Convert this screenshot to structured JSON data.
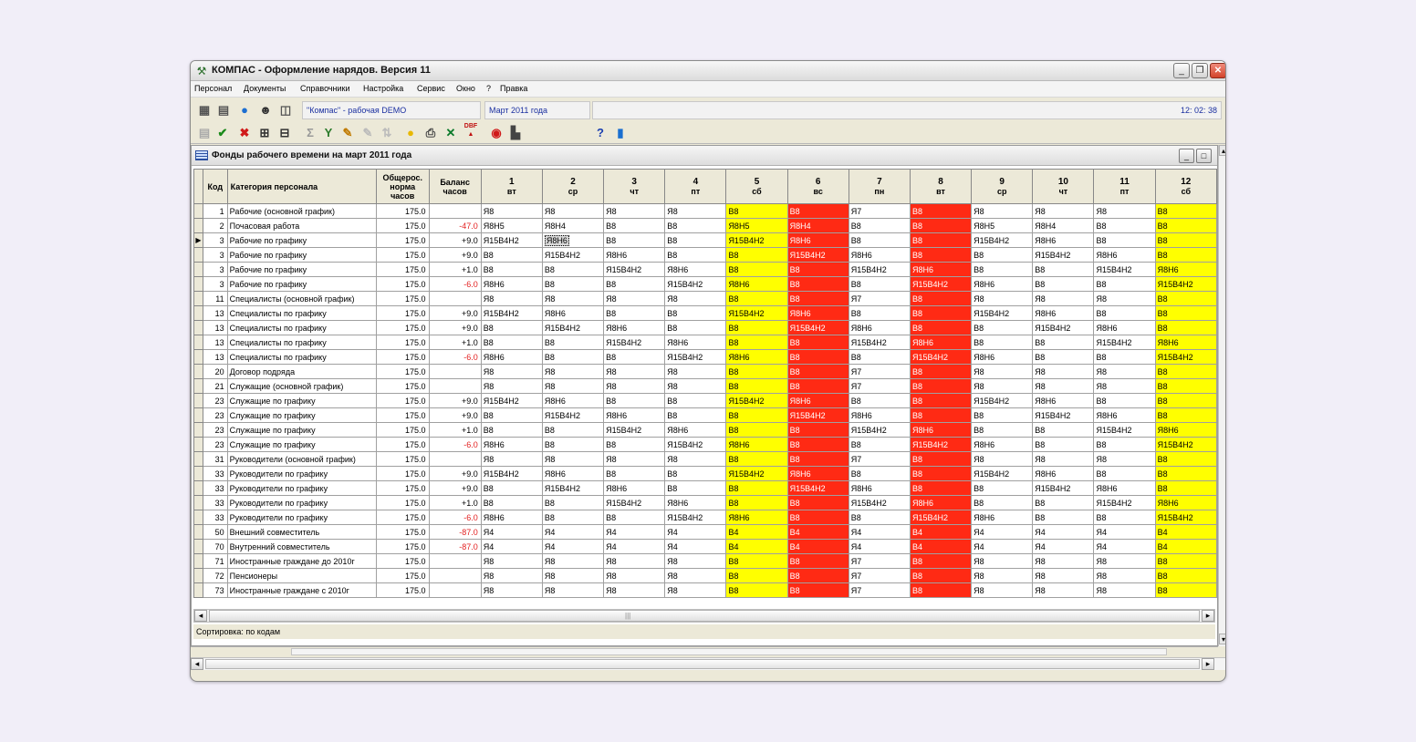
{
  "window": {
    "title": "КОМПАС - Оформление нарядов. Версия 11",
    "buttons": {
      "minimize": "_",
      "maximize": "❐",
      "close": "✕"
    }
  },
  "menu": [
    "Персонал",
    "Документы",
    "Справочники",
    "Настройка",
    "Сервис",
    "Окно",
    "?",
    "Правка"
  ],
  "toolbar": {
    "company": "\"Компас\" - рабочая DEMO",
    "period": "Март 2011 года",
    "clock": "12: 02: 38",
    "dbf_label": "DBF",
    "help": "?"
  },
  "icons": {
    "row1": [
      "calculator-icon",
      "calendar-icon",
      "globe-icon",
      "person-icon",
      "book-icon"
    ],
    "row2": [
      "list-icon",
      "check-icon",
      "delete-icon",
      "add-icon",
      "edit-icon",
      "sum-icon",
      "filter-icon",
      "mark-icon",
      "clear-icon",
      "sort-icon",
      "bulb-icon",
      "print-icon",
      "excel-icon",
      "dbf-export-icon",
      "recalc-icon",
      "chart-icon",
      "help-icon",
      "exit-icon"
    ]
  },
  "subwindow": {
    "title": "Фонды рабочего времени на март 2011 года",
    "status": "Сортировка: по кодам"
  },
  "grid": {
    "headers": {
      "code": "Код",
      "category": "Категория персонала",
      "norm": "Общерос. норма часов",
      "balance": "Баланс часов"
    },
    "days": [
      {
        "num": "1",
        "wd": "вт",
        "kind": "work"
      },
      {
        "num": "2",
        "wd": "ср",
        "kind": "work"
      },
      {
        "num": "3",
        "wd": "чт",
        "kind": "work"
      },
      {
        "num": "4",
        "wd": "пт",
        "kind": "work"
      },
      {
        "num": "5",
        "wd": "сб",
        "kind": "sat"
      },
      {
        "num": "6",
        "wd": "вс",
        "kind": "sun"
      },
      {
        "num": "7",
        "wd": "пн",
        "kind": "work"
      },
      {
        "num": "8",
        "wd": "вт",
        "kind": "sun"
      },
      {
        "num": "9",
        "wd": "ср",
        "kind": "work"
      },
      {
        "num": "10",
        "wd": "чт",
        "kind": "work"
      },
      {
        "num": "11",
        "wd": "пт",
        "kind": "work"
      },
      {
        "num": "12",
        "wd": "сб",
        "kind": "sat"
      }
    ],
    "rows": [
      {
        "code": "1",
        "category": "Рабочие (основной график)",
        "norm": "175.0",
        "balance": "",
        "cells": [
          "Я8",
          "Я8",
          "Я8",
          "Я8",
          "В8",
          "В8",
          "Я7",
          "В8",
          "Я8",
          "Я8",
          "Я8",
          "В8"
        ]
      },
      {
        "code": "2",
        "category": "Почасовая работа",
        "norm": "175.0",
        "balance": "-47.0",
        "cells": [
          "Я8Н5",
          "Я8Н4",
          "В8",
          "В8",
          "Я8Н5",
          "Я8Н4",
          "В8",
          "В8",
          "Я8Н5",
          "Я8Н4",
          "В8",
          "В8"
        ]
      },
      {
        "code": "3",
        "category": "Рабочие по графику",
        "norm": "175.0",
        "balance": "+9.0",
        "cells": [
          "Я15В4Н2",
          "Я8Н6",
          "В8",
          "В8",
          "Я15В4Н2",
          "Я8Н6",
          "В8",
          "В8",
          "Я15В4Н2",
          "Я8Н6",
          "В8",
          "В8"
        ]
      },
      {
        "code": "3",
        "category": "Рабочие по графику",
        "norm": "175.0",
        "balance": "+9.0",
        "cells": [
          "В8",
          "Я15В4Н2",
          "Я8Н6",
          "В8",
          "В8",
          "Я15В4Н2",
          "Я8Н6",
          "В8",
          "В8",
          "Я15В4Н2",
          "Я8Н6",
          "В8"
        ]
      },
      {
        "code": "3",
        "category": "Рабочие по графику",
        "norm": "175.0",
        "balance": "+1.0",
        "cells": [
          "В8",
          "В8",
          "Я15В4Н2",
          "Я8Н6",
          "В8",
          "В8",
          "Я15В4Н2",
          "Я8Н6",
          "В8",
          "В8",
          "Я15В4Н2",
          "Я8Н6"
        ]
      },
      {
        "code": "3",
        "category": "Рабочие по графику",
        "norm": "175.0",
        "balance": "-6.0",
        "cells": [
          "Я8Н6",
          "В8",
          "В8",
          "Я15В4Н2",
          "Я8Н6",
          "В8",
          "В8",
          "Я15В4Н2",
          "Я8Н6",
          "В8",
          "В8",
          "Я15В4Н2"
        ]
      },
      {
        "code": "11",
        "category": "Специалисты (основной график)",
        "norm": "175.0",
        "balance": "",
        "cells": [
          "Я8",
          "Я8",
          "Я8",
          "Я8",
          "В8",
          "В8",
          "Я7",
          "В8",
          "Я8",
          "Я8",
          "Я8",
          "В8"
        ]
      },
      {
        "code": "13",
        "category": "Специалисты по графику",
        "norm": "175.0",
        "balance": "+9.0",
        "cells": [
          "Я15В4Н2",
          "Я8Н6",
          "В8",
          "В8",
          "Я15В4Н2",
          "Я8Н6",
          "В8",
          "В8",
          "Я15В4Н2",
          "Я8Н6",
          "В8",
          "В8"
        ]
      },
      {
        "code": "13",
        "category": "Специалисты по графику",
        "norm": "175.0",
        "balance": "+9.0",
        "cells": [
          "В8",
          "Я15В4Н2",
          "Я8Н6",
          "В8",
          "В8",
          "Я15В4Н2",
          "Я8Н6",
          "В8",
          "В8",
          "Я15В4Н2",
          "Я8Н6",
          "В8"
        ]
      },
      {
        "code": "13",
        "category": "Специалисты по графику",
        "norm": "175.0",
        "balance": "+1.0",
        "cells": [
          "В8",
          "В8",
          "Я15В4Н2",
          "Я8Н6",
          "В8",
          "В8",
          "Я15В4Н2",
          "Я8Н6",
          "В8",
          "В8",
          "Я15В4Н2",
          "Я8Н6"
        ]
      },
      {
        "code": "13",
        "category": "Специалисты по графику",
        "norm": "175.0",
        "balance": "-6.0",
        "cells": [
          "Я8Н6",
          "В8",
          "В8",
          "Я15В4Н2",
          "Я8Н6",
          "В8",
          "В8",
          "Я15В4Н2",
          "Я8Н6",
          "В8",
          "В8",
          "Я15В4Н2"
        ]
      },
      {
        "code": "20",
        "category": "Договор подряда",
        "norm": "175.0",
        "balance": "",
        "cells": [
          "Я8",
          "Я8",
          "Я8",
          "Я8",
          "В8",
          "В8",
          "Я7",
          "В8",
          "Я8",
          "Я8",
          "Я8",
          "В8"
        ]
      },
      {
        "code": "21",
        "category": "Служащие (основной график)",
        "norm": "175.0",
        "balance": "",
        "cells": [
          "Я8",
          "Я8",
          "Я8",
          "Я8",
          "В8",
          "В8",
          "Я7",
          "В8",
          "Я8",
          "Я8",
          "Я8",
          "В8"
        ]
      },
      {
        "code": "23",
        "category": "Служащие по графику",
        "norm": "175.0",
        "balance": "+9.0",
        "cells": [
          "Я15В4Н2",
          "Я8Н6",
          "В8",
          "В8",
          "Я15В4Н2",
          "Я8Н6",
          "В8",
          "В8",
          "Я15В4Н2",
          "Я8Н6",
          "В8",
          "В8"
        ]
      },
      {
        "code": "23",
        "category": "Служащие по графику",
        "norm": "175.0",
        "balance": "+9.0",
        "cells": [
          "В8",
          "Я15В4Н2",
          "Я8Н6",
          "В8",
          "В8",
          "Я15В4Н2",
          "Я8Н6",
          "В8",
          "В8",
          "Я15В4Н2",
          "Я8Н6",
          "В8"
        ]
      },
      {
        "code": "23",
        "category": "Служащие по графику",
        "norm": "175.0",
        "balance": "+1.0",
        "cells": [
          "В8",
          "В8",
          "Я15В4Н2",
          "Я8Н6",
          "В8",
          "В8",
          "Я15В4Н2",
          "Я8Н6",
          "В8",
          "В8",
          "Я15В4Н2",
          "Я8Н6"
        ]
      },
      {
        "code": "23",
        "category": "Служащие по графику",
        "norm": "175.0",
        "balance": "-6.0",
        "cells": [
          "Я8Н6",
          "В8",
          "В8",
          "Я15В4Н2",
          "Я8Н6",
          "В8",
          "В8",
          "Я15В4Н2",
          "Я8Н6",
          "В8",
          "В8",
          "Я15В4Н2"
        ]
      },
      {
        "code": "31",
        "category": "Руководители (основной график)",
        "norm": "175.0",
        "balance": "",
        "cells": [
          "Я8",
          "Я8",
          "Я8",
          "Я8",
          "В8",
          "В8",
          "Я7",
          "В8",
          "Я8",
          "Я8",
          "Я8",
          "В8"
        ]
      },
      {
        "code": "33",
        "category": "Руководители по графику",
        "norm": "175.0",
        "balance": "+9.0",
        "cells": [
          "Я15В4Н2",
          "Я8Н6",
          "В8",
          "В8",
          "Я15В4Н2",
          "Я8Н6",
          "В8",
          "В8",
          "Я15В4Н2",
          "Я8Н6",
          "В8",
          "В8"
        ]
      },
      {
        "code": "33",
        "category": "Руководители по графику",
        "norm": "175.0",
        "balance": "+9.0",
        "cells": [
          "В8",
          "Я15В4Н2",
          "Я8Н6",
          "В8",
          "В8",
          "Я15В4Н2",
          "Я8Н6",
          "В8",
          "В8",
          "Я15В4Н2",
          "Я8Н6",
          "В8"
        ]
      },
      {
        "code": "33",
        "category": "Руководители по графику",
        "norm": "175.0",
        "balance": "+1.0",
        "cells": [
          "В8",
          "В8",
          "Я15В4Н2",
          "Я8Н6",
          "В8",
          "В8",
          "Я15В4Н2",
          "Я8Н6",
          "В8",
          "В8",
          "Я15В4Н2",
          "Я8Н6"
        ]
      },
      {
        "code": "33",
        "category": "Руководители по графику",
        "norm": "175.0",
        "balance": "-6.0",
        "cells": [
          "Я8Н6",
          "В8",
          "В8",
          "Я15В4Н2",
          "Я8Н6",
          "В8",
          "В8",
          "Я15В4Н2",
          "Я8Н6",
          "В8",
          "В8",
          "Я15В4Н2"
        ]
      },
      {
        "code": "50",
        "category": "Внешний совместитель",
        "norm": "175.0",
        "balance": "-87.0",
        "cells": [
          "Я4",
          "Я4",
          "Я4",
          "Я4",
          "В4",
          "В4",
          "Я4",
          "В4",
          "Я4",
          "Я4",
          "Я4",
          "В4"
        ]
      },
      {
        "code": "70",
        "category": "Внутренний совместитель",
        "norm": "175.0",
        "balance": "-87.0",
        "cells": [
          "Я4",
          "Я4",
          "Я4",
          "Я4",
          "В4",
          "В4",
          "Я4",
          "В4",
          "Я4",
          "Я4",
          "Я4",
          "В4"
        ]
      },
      {
        "code": "71",
        "category": "Иностранные граждане до 2010г",
        "norm": "175.0",
        "balance": "",
        "cells": [
          "Я8",
          "Я8",
          "Я8",
          "Я8",
          "В8",
          "В8",
          "Я7",
          "В8",
          "Я8",
          "Я8",
          "Я8",
          "В8"
        ]
      },
      {
        "code": "72",
        "category": "Пенсионеры",
        "norm": "175.0",
        "balance": "",
        "cells": [
          "Я8",
          "Я8",
          "Я8",
          "Я8",
          "В8",
          "В8",
          "Я7",
          "В8",
          "Я8",
          "Я8",
          "Я8",
          "В8"
        ]
      },
      {
        "code": "73",
        "category": "Иностранные граждане с 2010г",
        "norm": "175.0",
        "balance": "",
        "cells": [
          "Я8",
          "Я8",
          "Я8",
          "Я8",
          "В8",
          "В8",
          "Я7",
          "В8",
          "Я8",
          "Я8",
          "Я8",
          "В8"
        ]
      }
    ],
    "current_row": 2,
    "selected_day": 1,
    "current_marker": "▶"
  },
  "colors": {
    "saturday": "#ffff00",
    "holiday": "#ff2a14",
    "negative": "#e32020",
    "accent_text": "#1a2fa0"
  }
}
